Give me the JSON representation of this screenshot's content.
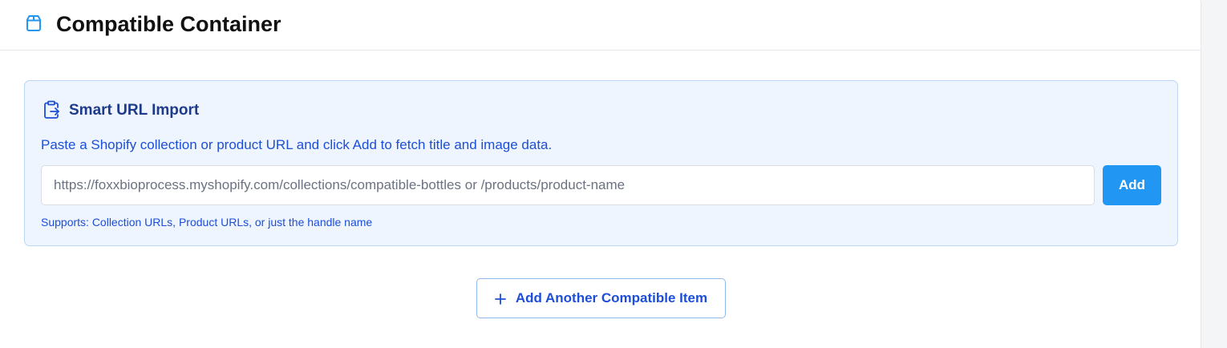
{
  "header": {
    "icon": "package-icon",
    "title": "Compatible Container"
  },
  "smart_import": {
    "icon": "clipboard-import-icon",
    "title": "Smart URL Import",
    "description": "Paste a Shopify collection or product URL and click Add to fetch title and image data.",
    "input_placeholder": "https://foxxbioprocess.myshopify.com/collections/compatible-bottles or /products/product-name",
    "input_value": "",
    "add_label": "Add",
    "hint": "Supports: Collection URLs, Product URLs, or just the handle name"
  },
  "add_another": {
    "icon": "plus-icon",
    "label": "Add Another Compatible Item"
  },
  "colors": {
    "accent": "#2196f3",
    "panel_bg": "#eef5ff",
    "panel_border": "#bcd7f5",
    "text_blue": "#1d4ed8",
    "title_blue": "#1e3a8a"
  }
}
